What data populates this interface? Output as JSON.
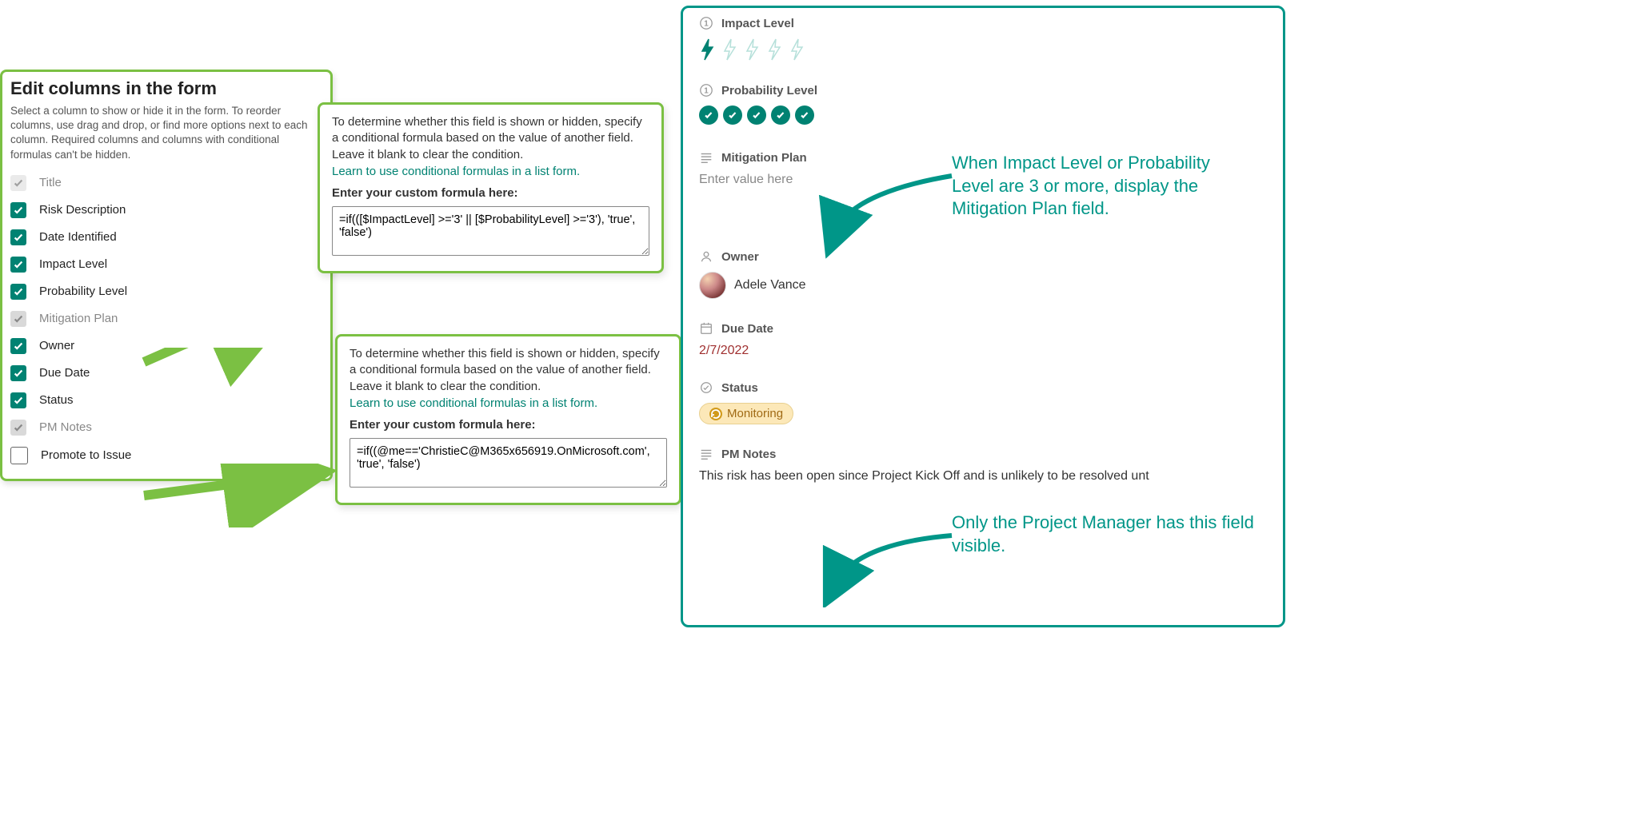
{
  "edit_panel": {
    "title": "Edit columns in the form",
    "subtitle": "Select a column to show or hide it in the form. To reorder columns, use drag and drop, or find more options next to each column. Required columns and columns with conditional formulas can't be hidden.",
    "columns": [
      {
        "label": "Title",
        "state": "locked"
      },
      {
        "label": "Risk Description",
        "state": "checked"
      },
      {
        "label": "Date Identified",
        "state": "checked"
      },
      {
        "label": "Impact Level",
        "state": "checked"
      },
      {
        "label": "Probability Level",
        "state": "checked"
      },
      {
        "label": "Mitigation Plan",
        "state": "conditional"
      },
      {
        "label": "Owner",
        "state": "checked"
      },
      {
        "label": "Due Date",
        "state": "checked"
      },
      {
        "label": "Status",
        "state": "checked"
      },
      {
        "label": "PM Notes",
        "state": "conditional"
      },
      {
        "label": "Promote to Issue",
        "state": "empty"
      }
    ]
  },
  "formula_popups": {
    "description": "To determine whether this field is shown or hidden, specify a conditional formula based on the value of another field. Leave it blank to clear the condition.",
    "learn_link": "Learn to use conditional formulas in a list form.",
    "field_label": "Enter your custom formula here:",
    "formula1": "=if(([$ImpactLevel] >='3' || [$ProbabilityLevel] >='3'), 'true', 'false')",
    "formula2": "=if((@me=='ChristieC@M365x656919.OnMicrosoft.com', 'true', 'false')"
  },
  "form_preview": {
    "impact_level": {
      "label": "Impact Level",
      "value": 1,
      "max": 5
    },
    "probability_level": {
      "label": "Probability Level",
      "value": 5,
      "max": 5
    },
    "mitigation_plan": {
      "label": "Mitigation Plan",
      "placeholder": "Enter value here"
    },
    "owner": {
      "label": "Owner",
      "name": "Adele Vance"
    },
    "due_date": {
      "label": "Due Date",
      "value": "2/7/2022"
    },
    "status": {
      "label": "Status",
      "value": "Monitoring"
    },
    "pm_notes": {
      "label": "PM Notes",
      "value": "This risk has been open since Project Kick Off and is unlikely to be resolved unt"
    }
  },
  "annotations": {
    "mitigation": "When Impact Level or Probability Level are 3 or more, display the Mitigation Plan field.",
    "pm_notes": "Only the Project Manager has this field visible."
  }
}
